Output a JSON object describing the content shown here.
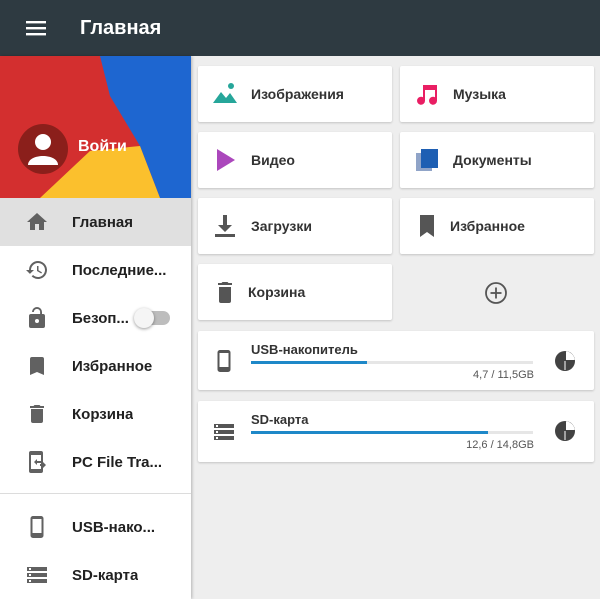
{
  "app_bar": {
    "title": "Главная",
    "menu_icon": "hamburger-menu-icon"
  },
  "drawer": {
    "header": {
      "login_label": "Войти"
    },
    "items": [
      {
        "label": "Главная",
        "icon": "home-icon",
        "active": true
      },
      {
        "label": "Последние...",
        "icon": "history-icon"
      },
      {
        "label": "Безоп...",
        "icon": "lock-icon",
        "toggle": false
      },
      {
        "label": "Избранное",
        "icon": "bookmark-icon"
      },
      {
        "label": "Корзина",
        "icon": "trash-icon"
      },
      {
        "label": "PC File Tra...",
        "icon": "transfer-icon"
      },
      {
        "label": "USB-нако...",
        "icon": "phone-icon"
      },
      {
        "label": "SD-карта",
        "icon": "storage-icon"
      }
    ]
  },
  "categories": [
    {
      "label": "Изображения",
      "icon": "image-icon",
      "color": "#26a69a"
    },
    {
      "label": "Музыка",
      "icon": "music-note-icon",
      "color": "#e91e63"
    },
    {
      "label": "Видео",
      "icon": "play-icon",
      "color": "#ab47bc"
    },
    {
      "label": "Документы",
      "icon": "documents-icon",
      "color": "#1e5fb3"
    },
    {
      "label": "Загрузки",
      "icon": "download-icon",
      "color": "#555555"
    },
    {
      "label": "Избранное",
      "icon": "bookmark-icon",
      "color": "#555555"
    },
    {
      "label": "Корзина",
      "icon": "trash-icon",
      "color": "#555555"
    }
  ],
  "add_button": {
    "icon": "add-circle-icon"
  },
  "storage": [
    {
      "name": "USB-накопитель",
      "size": "4,7 / 11,5GB",
      "used_fraction": 0.41,
      "icon": "phone-icon"
    },
    {
      "name": "SD-карта",
      "size": "12,6 / 14,8GB",
      "used_fraction": 0.84,
      "icon": "storage-icon"
    }
  ],
  "colors": {
    "app_bar": "#2e3a41",
    "accent": "#1e88c8"
  }
}
